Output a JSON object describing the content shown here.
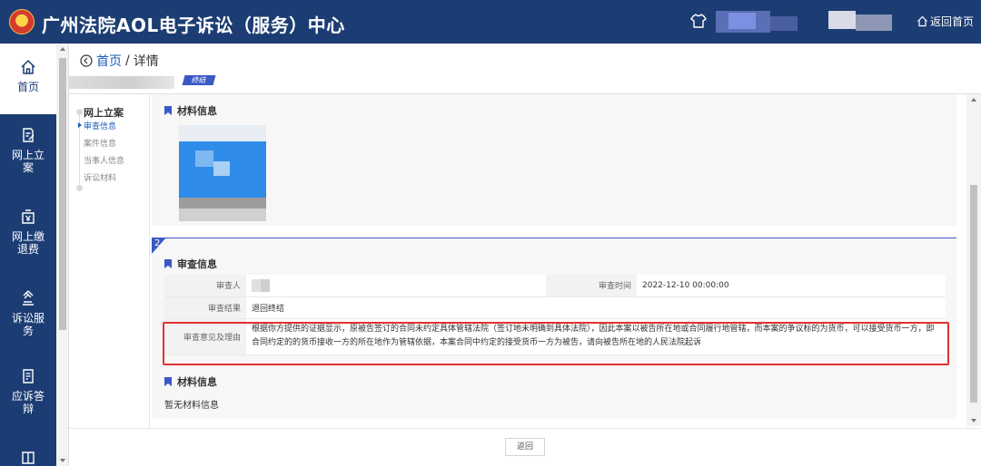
{
  "header": {
    "title": "广州法院AOL电子诉讼（服务）中心",
    "home_link": "返回首页",
    "bg_color": "#1c3d73"
  },
  "sidebar": {
    "items": [
      {
        "label": "首页",
        "icon": "home-icon"
      },
      {
        "label": "网上立案",
        "icon": "edit-document-icon"
      },
      {
        "label": "网上缴退费",
        "icon": "money-icon"
      },
      {
        "label": "诉讼服务",
        "icon": "gavel-icon"
      },
      {
        "label": "应诉答辩",
        "icon": "reply-document-icon"
      }
    ]
  },
  "breadcrumb": {
    "home": "首页",
    "separator": "/",
    "current": "详情"
  },
  "case": {
    "status_tag": "终结"
  },
  "left_nav": {
    "heading": "网上立案",
    "items": [
      "审查信息",
      "案件信息",
      "当事人信息",
      "诉讼材料"
    ]
  },
  "materials_section_1": {
    "title": "材料信息"
  },
  "review_section": {
    "number": "2",
    "title": "审查信息",
    "reviewer_label": "审查人",
    "review_time_label": "审查时间",
    "review_time": "2022-12-10 00:00:00",
    "result_label": "审查结果",
    "result": "退回终结",
    "reason_label": "审查意见及理由",
    "reason": "根据你方提供的证据显示，原被告签订的合同未约定具体管辖法院（签订地未明确到具体法院），因此本案以被告所在地或合同履行地管辖，而本案的争议标的为货币，可以接受货币一方，即合同约定的的货币接收一方的所在地作为管辖依据，本案合同中约定的接受货币一方为被告，请向被告所在地的人民法院起诉"
  },
  "materials_section_2": {
    "title": "材料信息",
    "empty_text": "暂无材料信息"
  },
  "footer": {
    "back_label": "返回"
  },
  "colors": {
    "accent": "#3a59c6",
    "link": "#1c5cb8",
    "highlight": "#e3312d"
  }
}
